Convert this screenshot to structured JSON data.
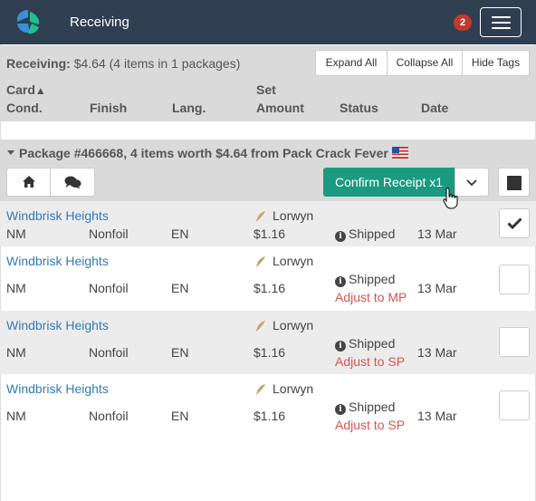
{
  "navbar": {
    "title": "Receiving",
    "notification_count": "2",
    "brand_colors": {
      "background": "#2f3e50",
      "logo_blue": "#3a8fd6",
      "logo_teal": "#1fbf8f"
    }
  },
  "summary": {
    "label": "Receiving:",
    "value": "$4.64 (4 items in 1 packages)",
    "buttons": {
      "expand_all": "Expand All",
      "collapse_all": "Collapse All",
      "hide_tags": "Hide Tags"
    }
  },
  "columns": {
    "card": "Card",
    "set": "Set",
    "cond": "Cond.",
    "finish": "Finish",
    "lang": "Lang.",
    "amount": "Amount",
    "status": "Status",
    "date": "Date"
  },
  "package": {
    "title": "Package #466668, 4 items worth $4.64 from Pack Crack Fever",
    "flag": "us-flag-icon",
    "confirm_label": "Confirm Receipt x1",
    "accent_color": "#1a9a7f"
  },
  "items": [
    {
      "name": "Windbrisk Heights",
      "set": "Lorwyn",
      "cond": "NM",
      "finish": "Nonfoil",
      "lang": "EN",
      "amount": "$1.16",
      "status": "Shipped",
      "adjust": "",
      "date": "13 Mar",
      "checked": true
    },
    {
      "name": "Windbrisk Heights",
      "set": "Lorwyn",
      "cond": "NM",
      "finish": "Nonfoil",
      "lang": "EN",
      "amount": "$1.16",
      "status": "Shipped",
      "adjust": "Adjust to MP",
      "date": "13 Mar",
      "checked": false
    },
    {
      "name": "Windbrisk Heights",
      "set": "Lorwyn",
      "cond": "NM",
      "finish": "Nonfoil",
      "lang": "EN",
      "amount": "$1.16",
      "status": "Shipped",
      "adjust": "Adjust to SP",
      "date": "13 Mar",
      "checked": false
    },
    {
      "name": "Windbrisk Heights",
      "set": "Lorwyn",
      "cond": "NM",
      "finish": "Nonfoil",
      "lang": "EN",
      "amount": "$1.16",
      "status": "Shipped",
      "adjust": "Adjust to SP",
      "date": "13 Mar",
      "checked": false
    }
  ]
}
